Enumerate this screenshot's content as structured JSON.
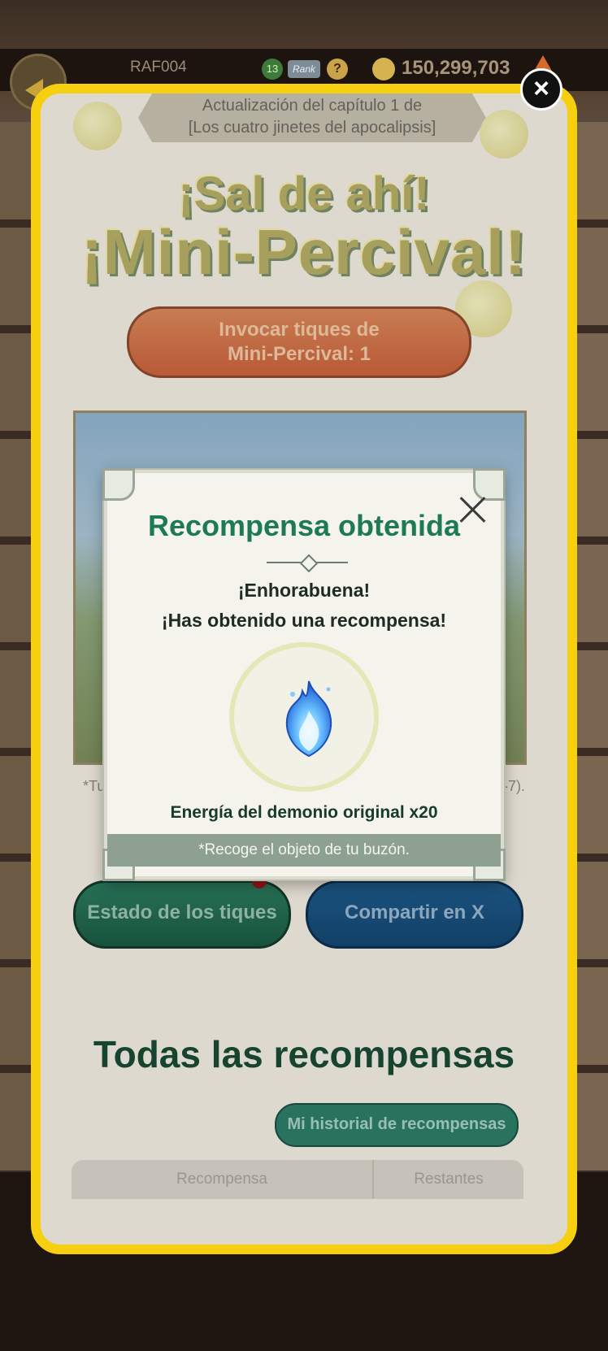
{
  "topbar": {
    "player_id": "RAF004",
    "level": "13",
    "rank_label": "Rank",
    "help_label": "?",
    "gold": "150,299,703"
  },
  "event": {
    "chapter_line1": "Actualización del capítulo 1 de",
    "chapter_line2": "[Los cuatro jinetes del apocalipsis]",
    "title_line1": "¡Sal de ahí!",
    "title_line2": "¡Mini-Percival!",
    "summon_line1": "Invocar tiques de",
    "summon_line2": "Mini-Percival: 1",
    "footnote_left": "*Tu",
    "footnote_right": "C-7).",
    "status_button": "Estado de los tiques",
    "share_button": "Compartir en X",
    "all_rewards_title": "Todas las recompensas",
    "history_button": "Mi historial de recompensas",
    "table_headers": [
      "Recompensa",
      "Restantes"
    ]
  },
  "modal": {
    "title": "Recompensa obtenida",
    "congrats_line1": "¡Enhorabuena!",
    "congrats_line2": "¡Has obtenido una recompensa!",
    "item_name": "Energía del demonio original x20",
    "item_icon": "blue-flame-icon",
    "mailbox_note": "*Recoge el objeto de tu buzón."
  },
  "colors": {
    "panel_border": "#f6cf10",
    "modal_title": "#1d7a52",
    "status_button": "#2b7a5e",
    "share_button": "#1e5a8a"
  }
}
